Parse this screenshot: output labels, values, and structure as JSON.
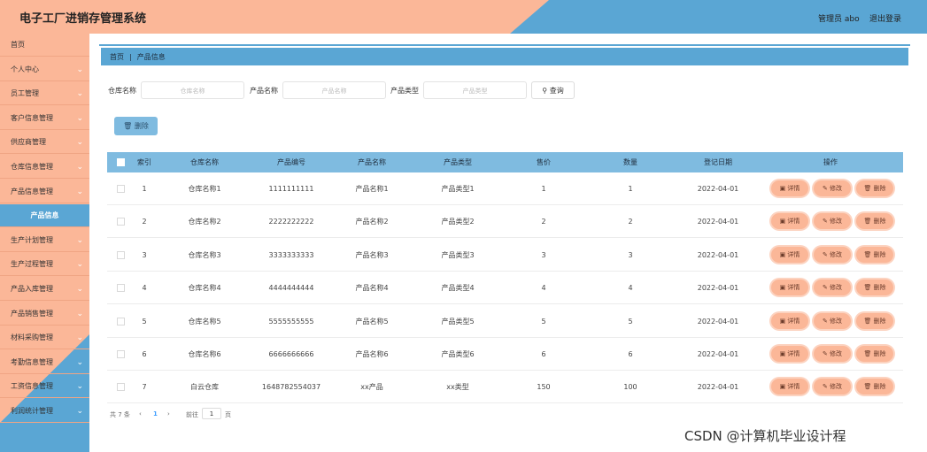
{
  "header": {
    "title": "电子工厂进销存管理系统",
    "user": "管理员 abo",
    "logout": "退出登录"
  },
  "sidebar": {
    "items": [
      {
        "label": "首页",
        "has_chevron": false
      },
      {
        "label": "个人中心",
        "has_chevron": true
      },
      {
        "label": "员工管理",
        "has_chevron": true
      },
      {
        "label": "客户信息管理",
        "has_chevron": true
      },
      {
        "label": "供应商管理",
        "has_chevron": true
      },
      {
        "label": "仓库信息管理",
        "has_chevron": true
      },
      {
        "label": "产品信息管理",
        "has_chevron": true
      },
      {
        "label": "产品信息",
        "has_chevron": false,
        "active": true
      },
      {
        "label": "生产计划管理",
        "has_chevron": true
      },
      {
        "label": "生产过程管理",
        "has_chevron": true
      },
      {
        "label": "产品入库管理",
        "has_chevron": true
      },
      {
        "label": "产品销售管理",
        "has_chevron": true
      },
      {
        "label": "材料采购管理",
        "has_chevron": true
      },
      {
        "label": "考勤信息管理",
        "has_chevron": true
      },
      {
        "label": "工资信息管理",
        "has_chevron": true
      },
      {
        "label": "利润统计管理",
        "has_chevron": true
      }
    ]
  },
  "breadcrumb": {
    "home": "首页",
    "separator": "|",
    "current": "产品信息"
  },
  "search": {
    "warehouse_label": "仓库名称",
    "warehouse_placeholder": "仓库名称",
    "product_label": "产品名称",
    "product_placeholder": "产品名称",
    "type_label": "产品类型",
    "type_placeholder": "产品类型",
    "query_button": "查询"
  },
  "toolbar": {
    "delete_button": "删除"
  },
  "table": {
    "headers": [
      "索引",
      "仓库名称",
      "产品编号",
      "产品名称",
      "产品类型",
      "售价",
      "数量",
      "登记日期",
      "操作"
    ],
    "actions": {
      "detail": "详情",
      "edit": "修改",
      "delete": "删除"
    },
    "rows": [
      [
        "1",
        "仓库名称1",
        "1111111111",
        "产品名称1",
        "产品类型1",
        "1",
        "1",
        "2022-04-01"
      ],
      [
        "2",
        "仓库名称2",
        "2222222222",
        "产品名称2",
        "产品类型2",
        "2",
        "2",
        "2022-04-01"
      ],
      [
        "3",
        "仓库名称3",
        "3333333333",
        "产品名称3",
        "产品类型3",
        "3",
        "3",
        "2022-04-01"
      ],
      [
        "4",
        "仓库名称4",
        "4444444444",
        "产品名称4",
        "产品类型4",
        "4",
        "4",
        "2022-04-01"
      ],
      [
        "5",
        "仓库名称5",
        "5555555555",
        "产品名称5",
        "产品类型5",
        "5",
        "5",
        "2022-04-01"
      ],
      [
        "6",
        "仓库名称6",
        "6666666666",
        "产品名称6",
        "产品类型6",
        "6",
        "6",
        "2022-04-01"
      ],
      [
        "7",
        "白云仓库",
        "1648782554037",
        "xx产品",
        "xx类型",
        "150",
        "100",
        "2022-04-01"
      ]
    ]
  },
  "pagination": {
    "total": "共 7 条",
    "prev": "‹",
    "page": "1",
    "next": "›",
    "goto": "前往",
    "goto_value": "1",
    "unit": "页"
  },
  "watermark": "CSDN @计算机毕业设计程",
  "colors": {
    "peach": "#fbb798",
    "blue": "#5aa6d4",
    "light_blue": "#7fbbe0"
  }
}
